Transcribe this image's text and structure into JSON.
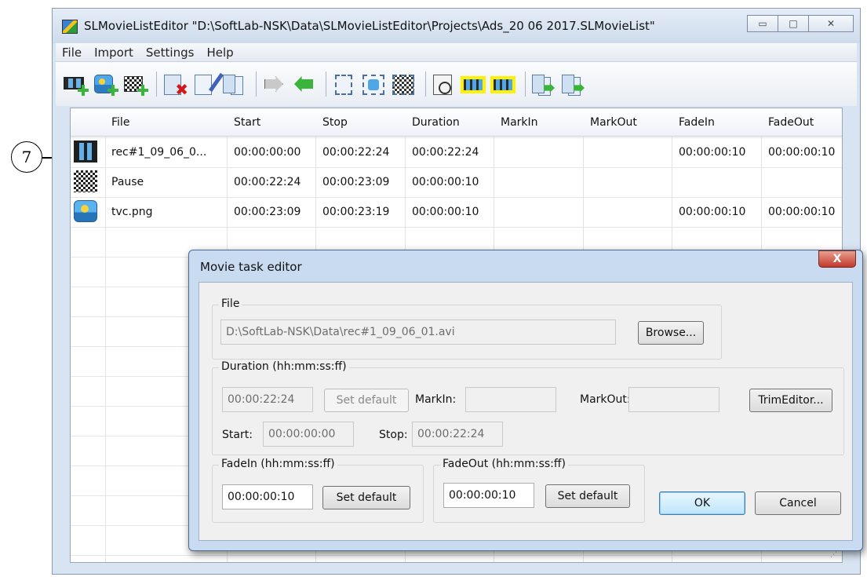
{
  "callout": {
    "number": "7"
  },
  "window": {
    "title": "SLMovieListEditor \"D:\\SoftLab-NSK\\Data\\SLMovieListEditor\\Projects\\Ads_20 06 2017.SLMovieList\"",
    "controls": {
      "minimize": "▭",
      "maximize": "□",
      "close": "✕"
    }
  },
  "menu": [
    "File",
    "Import",
    "Settings",
    "Help"
  ],
  "toolbar": {
    "icons": [
      "add-movie-icon",
      "add-picture-icon",
      "add-pause-icon",
      "delete-icon",
      "edit-icon",
      "copy-icon",
      "move-right-icon",
      "move-left-icon",
      "select-movie-icon",
      "select-picture-icon",
      "select-pause-icon",
      "duration-icon",
      "film-highlight-icon",
      "film-highlight-2-icon",
      "sequence-icon",
      "sequence-2-icon"
    ]
  },
  "grid": {
    "columns": [
      "File",
      "Start",
      "Stop",
      "Duration",
      "MarkIn",
      "MarkOut",
      "FadeIn",
      "FadeOut"
    ],
    "rows": [
      {
        "icon": "movie",
        "file": "rec#1_09_06_0...",
        "start": "00:00:00:00",
        "stop": "00:00:22:24",
        "duration": "00:00:22:24",
        "markin": "",
        "markout": "",
        "fadein": "00:00:00:10",
        "fadeout": "00:00:00:10"
      },
      {
        "icon": "pause",
        "file": "Pause",
        "start": "00:00:22:24",
        "stop": "00:00:23:09",
        "duration": "00:00:00:10",
        "markin": "",
        "markout": "",
        "fadein": "",
        "fadeout": ""
      },
      {
        "icon": "picture",
        "file": "tvc.png",
        "start": "00:00:23:09",
        "stop": "00:00:23:19",
        "duration": "00:00:00:10",
        "markin": "",
        "markout": "",
        "fadein": "00:00:00:10",
        "fadeout": "00:00:00:10"
      }
    ]
  },
  "dialog": {
    "title": "Movie task editor",
    "close": "X",
    "file": {
      "legend": "File",
      "path": "D:\\SoftLab-NSK\\Data\\rec#1_09_06_01.avi",
      "browse": "Browse..."
    },
    "duration": {
      "legend": "Duration (hh:mm:ss:ff)",
      "value": "00:00:22:24",
      "set_default": "Set default",
      "markin_label": "MarkIn:",
      "markin_value": "",
      "markout_label": "MarkOut:",
      "markout_value": "",
      "trim_editor": "TrimEditor...",
      "start_label": "Start:",
      "start_value": "00:00:00:00",
      "stop_label": "Stop:",
      "stop_value": "00:00:22:24"
    },
    "fadein": {
      "legend": "FadeIn (hh:mm:ss:ff)",
      "value": "00:00:00:10",
      "set_default": "Set default"
    },
    "fadeout": {
      "legend": "FadeOut (hh:mm:ss:ff)",
      "value": "00:00:00:10",
      "set_default": "Set default"
    },
    "ok": "OK",
    "cancel": "Cancel"
  },
  "colors": {
    "window_frame": "#d9e4f2",
    "dialog_frame": "#c9dbf0",
    "close_red": "#c0392b",
    "accent_blue": "#3c7fb1"
  }
}
